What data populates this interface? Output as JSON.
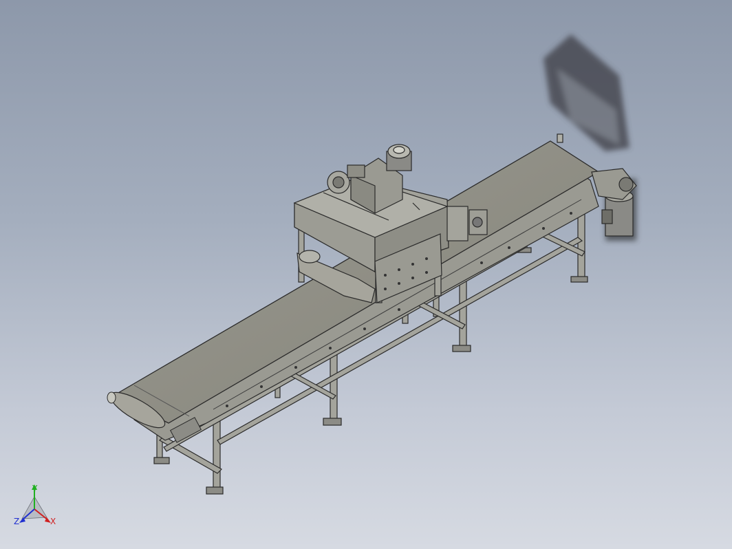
{
  "viewport": {
    "background_top": "#8d98aa",
    "background_bottom": "#d6dae2"
  },
  "model": {
    "frame_color": "#9a9a92",
    "belt_color": "#8f8e84",
    "edge_color": "#2a2a2a",
    "motor_color": "#8a8a86"
  },
  "triad": {
    "x_label": "X",
    "y_label": "Y",
    "z_label": "Z",
    "x_color": "#d02020",
    "y_color": "#20b020",
    "z_color": "#2030d0"
  }
}
